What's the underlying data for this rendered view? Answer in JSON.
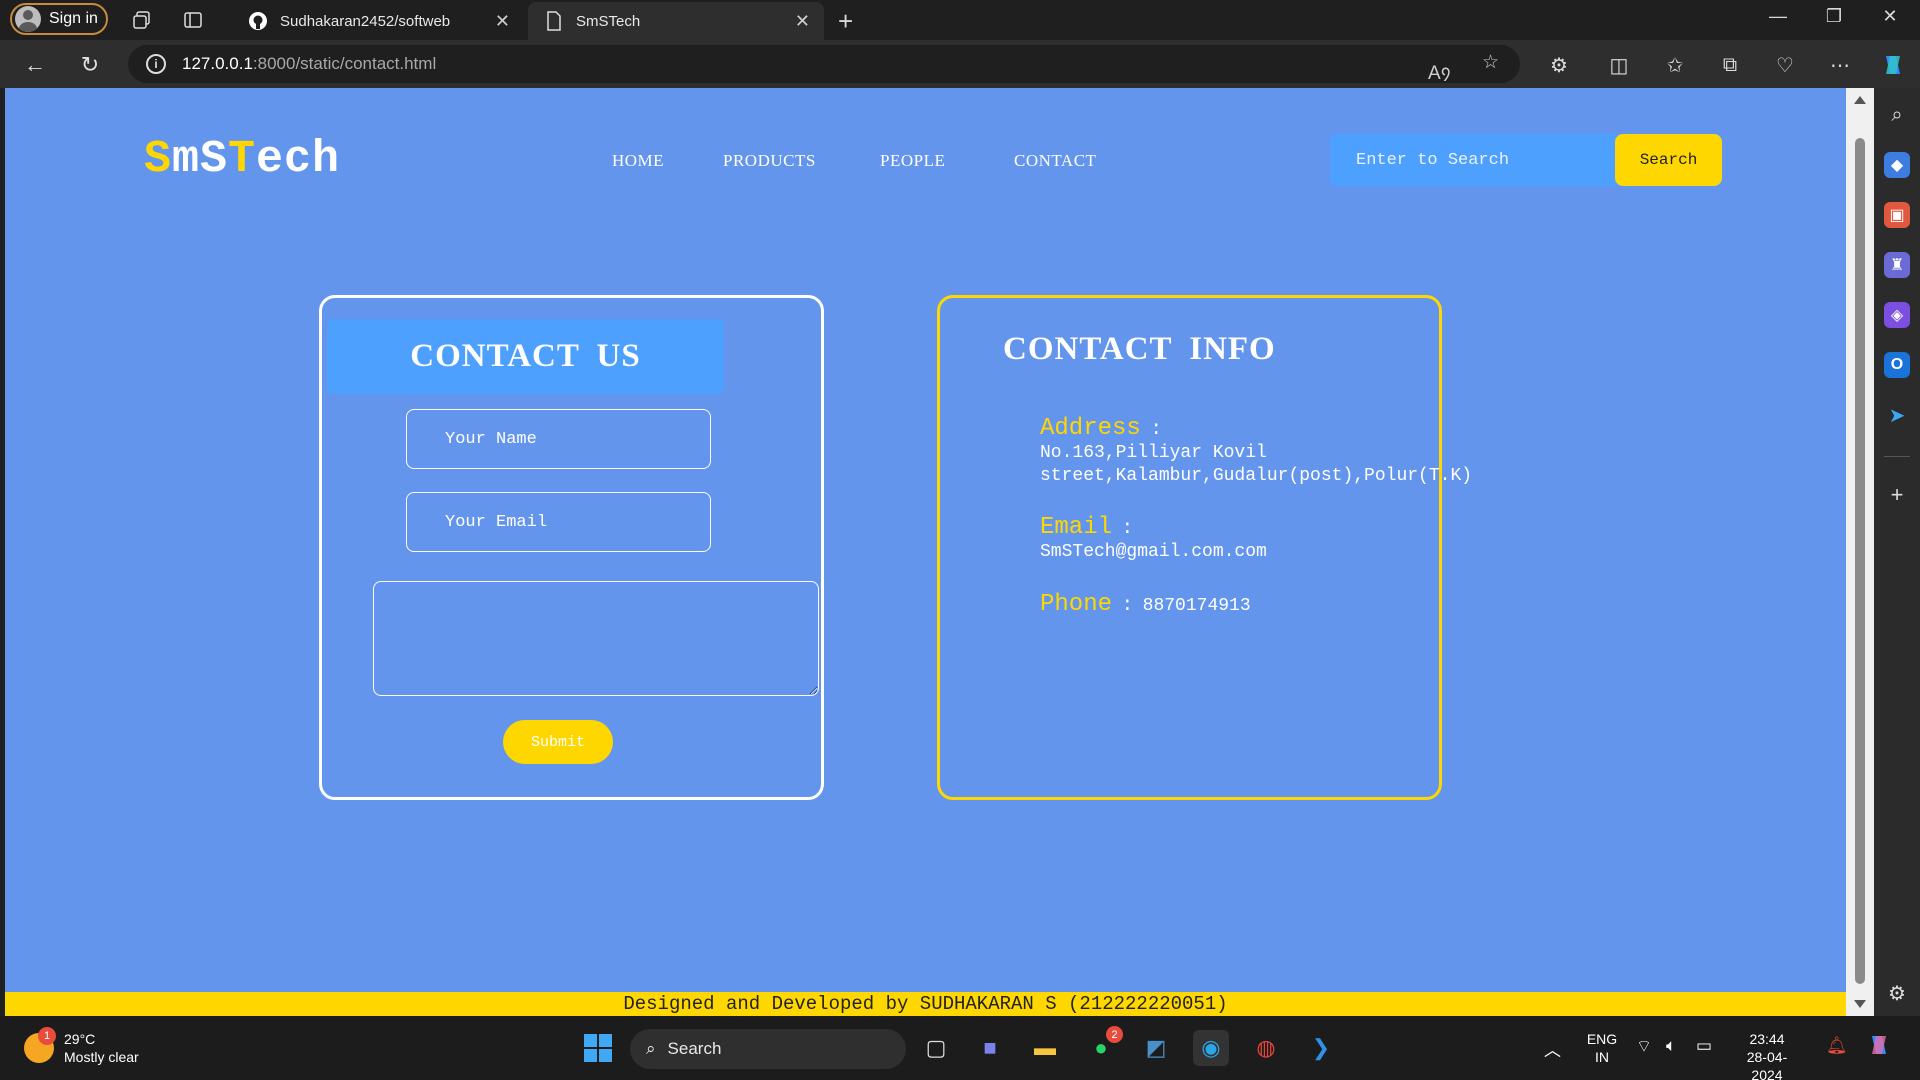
{
  "browser": {
    "signin_label": "Sign in",
    "tabs": [
      {
        "title": "Sudhakaran2452/softweb",
        "icon": "github-icon"
      },
      {
        "title": "SmSTech",
        "icon": "page-icon"
      }
    ],
    "url_host": "127.0.0.1",
    "url_path": ":8000/static/contact.html"
  },
  "site": {
    "logo_parts": [
      "S",
      "mS",
      "T",
      "ech"
    ],
    "nav": [
      "HOME",
      "PRODUCTS",
      "PEOPLE",
      "CONTACT"
    ],
    "search_placeholder": "Enter to Search",
    "search_button": "Search",
    "accent_yellow": "#ffd700",
    "bg_blue": "#6495ed",
    "panel_blue": "#4ea0ff"
  },
  "contact_form": {
    "title": "CONTACT US",
    "name_placeholder": "Your Name",
    "email_placeholder": "Your Email",
    "submit_label": "Submit"
  },
  "contact_info": {
    "title": "CONTACT INFO",
    "address_label": "Address",
    "address_line1": "No.163,Pilliyar Kovil",
    "address_line2": "street,Kalambur,Gudalur(post),Polur(T.K)",
    "email_label": "Email",
    "email_value": "SmSTech@gmail.com.com",
    "phone_label": "Phone",
    "phone_value": "8870174913",
    "colon": ":"
  },
  "footer": {
    "text": "Designed and Developed by SUDHAKARAN S (212222220051)"
  },
  "taskbar": {
    "weather_temp": "29°C",
    "weather_desc": "Mostly clear",
    "weather_badge": "1",
    "search_label": "Search",
    "whatsapp_badge": "2",
    "lang_top": "ENG",
    "lang_bottom": "IN",
    "time": "23:44",
    "date": "28-04-2024"
  }
}
